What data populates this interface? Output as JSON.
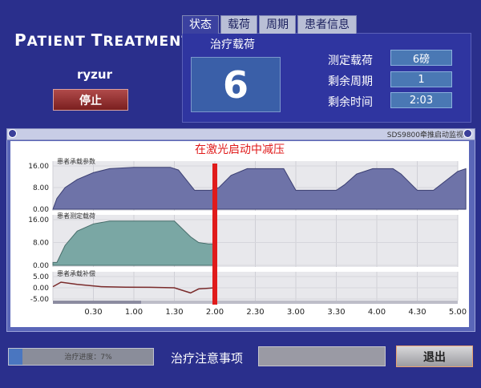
{
  "app_title_prefix": "P",
  "app_title_mid": "ATIENT ",
  "app_title_prefix2": "T",
  "app_title_rest": "REATMENT",
  "user": "ryzur",
  "stop_button": "停止",
  "tabs": [
    "状态",
    "载荷",
    "周期",
    "患者信息"
  ],
  "active_tab": 0,
  "load_label": "治疗载荷",
  "load_value": "6",
  "stats": [
    {
      "label": "测定载荷",
      "value": "6磅"
    },
    {
      "label": "剩余周期",
      "value": "1"
    },
    {
      "label": "剩余时间",
      "value": "2:03"
    }
  ],
  "chart_window_title": "SDS9800牵推启动监视",
  "progress": {
    "label": "治疗进度：7%",
    "percent": 7
  },
  "notice_label": "治疗注意事项",
  "exit_button": "退出",
  "colors": {
    "bg": "#2a2f8c",
    "series1": "#6e73a8",
    "series2": "#7aa7a4",
    "marker": "#e01b1b"
  },
  "chart_data": [
    {
      "type": "area",
      "title": "在激光启动中减压",
      "ylabel": "患者承载参数",
      "yticks": [
        "16.00",
        "8.00",
        "0.00"
      ],
      "ylim": [
        0,
        16
      ],
      "x": [
        0,
        0.05,
        0.15,
        0.3,
        0.5,
        0.7,
        1.0,
        1.2,
        1.45,
        1.55,
        1.75,
        1.95,
        2.05,
        2.2,
        2.4,
        2.7,
        2.85,
        3.0,
        3.2,
        3.5,
        3.6,
        3.75,
        3.95,
        4.2,
        4.3,
        4.5,
        4.7,
        5.0,
        5.1
      ],
      "values": [
        0,
        4,
        8,
        11,
        13.5,
        15,
        15.5,
        15.5,
        15.5,
        14.5,
        7,
        7,
        8,
        12.5,
        15,
        15,
        15,
        7,
        7,
        7,
        9,
        13,
        15,
        15,
        13,
        7,
        7,
        14,
        15
      ]
    },
    {
      "type": "area",
      "ylabel": "患者测定载荷",
      "yticks": [
        "16.00",
        "8.00",
        "0.00"
      ],
      "ylim": [
        0,
        16
      ],
      "x": [
        0,
        0.05,
        0.15,
        0.3,
        0.5,
        0.7,
        1.0,
        1.2,
        1.5,
        1.7,
        1.8,
        1.92,
        2.0
      ],
      "values": [
        1,
        1,
        7,
        12,
        14.5,
        15.5,
        15.5,
        15.5,
        15.5,
        10,
        8,
        7.5,
        7.5
      ]
    },
    {
      "type": "line",
      "ylabel": "患者承载补偿",
      "yticks": [
        "5.00",
        "0.00",
        "-5.00"
      ],
      "ylim": [
        -5,
        5
      ],
      "x": [
        0,
        0.1,
        0.3,
        0.6,
        0.9,
        1.2,
        1.5,
        1.7,
        1.8,
        2.0
      ],
      "values": [
        0.5,
        2.5,
        1.5,
        0.5,
        0.3,
        0.2,
        0,
        -2.3,
        -0.5,
        0
      ]
    }
  ],
  "x_axis": {
    "ticks": [
      "0.30",
      "1.00",
      "1.30",
      "2.00",
      "2.30",
      "3.00",
      "3.30",
      "4.00",
      "4.30",
      "5.00"
    ],
    "xlim": [
      0,
      5.0
    ],
    "marker_x": 2.0
  }
}
